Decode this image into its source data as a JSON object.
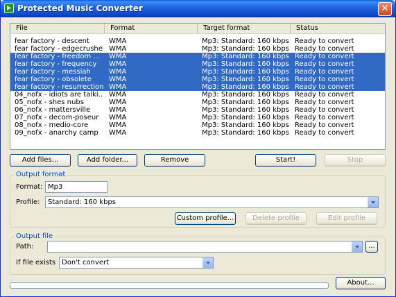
{
  "window": {
    "title": "Protected Music Converter",
    "close_label": "✕"
  },
  "columns": [
    "File",
    "Format",
    "Target format",
    "Status"
  ],
  "rows": [
    {
      "file": "fear factory - descent",
      "format": "WMA",
      "target": "Mp3: Standard: 160 kbps",
      "status": "Ready to convert",
      "selected": false
    },
    {
      "file": "fear factory - edgecrusher",
      "format": "WMA",
      "target": "Mp3: Standard: 160 kbps",
      "status": "Ready to convert",
      "selected": false
    },
    {
      "file": "fear factory - freedom ...",
      "format": "WMA",
      "target": "Mp3: Standard: 160 kbps",
      "status": "Ready to convert",
      "selected": true
    },
    {
      "file": "fear factory - frequency",
      "format": "WMA",
      "target": "Mp3: Standard: 160 kbps",
      "status": "Ready to convert",
      "selected": true
    },
    {
      "file": "fear factory - messiah",
      "format": "WMA",
      "target": "Mp3: Standard: 160 kbps",
      "status": "Ready to convert",
      "selected": true
    },
    {
      "file": "fear factory - obsolete",
      "format": "WMA",
      "target": "Mp3: Standard: 160 kbps",
      "status": "Ready to convert",
      "selected": true
    },
    {
      "file": "fear factory - resurrection",
      "format": "WMA",
      "target": "Mp3: Standard: 160 kbps",
      "status": "Ready to convert",
      "selected": true
    },
    {
      "file": "04_nofx - idiots are talki...",
      "format": "WMA",
      "target": "Mp3: Standard: 160 kbps",
      "status": "Ready to convert",
      "selected": false
    },
    {
      "file": "05_nofx - shes nubs",
      "format": "WMA",
      "target": "Mp3: Standard: 160 kbps",
      "status": "Ready to convert",
      "selected": false
    },
    {
      "file": "06_nofx - mattersville",
      "format": "WMA",
      "target": "Mp3: Standard: 160 kbps",
      "status": "Ready to convert",
      "selected": false
    },
    {
      "file": "07_nofx - decom-poseur",
      "format": "WMA",
      "target": "Mp3: Standard: 160 kbps",
      "status": "Ready to convert",
      "selected": false
    },
    {
      "file": "08_nofx - medio-core",
      "format": "WMA",
      "target": "Mp3: Standard: 160 kbps",
      "status": "Ready to convert",
      "selected": false
    },
    {
      "file": "09_nofx - anarchy camp",
      "format": "WMA",
      "target": "Mp3: Standard: 160 kbps",
      "status": "Ready to convert",
      "selected": false
    }
  ],
  "buttons": {
    "add_files": "Add files...",
    "add_folder": "Add folder...",
    "remove": "Remove",
    "start": "Start!",
    "stop": "Stop",
    "custom_profile": "Custom profile...",
    "delete_profile": "Delete profile",
    "edit_profile": "Edit profile",
    "browse": "...",
    "about": "About..."
  },
  "output_format": {
    "group_title": "Output format",
    "format_label": "Format:",
    "format_value": "Mp3",
    "profile_label": "Profile:",
    "profile_value": "Standard: 160 kbps"
  },
  "output_file": {
    "group_title": "Output file",
    "path_label": "Path:",
    "path_value": "",
    "exists_label": "If file exists",
    "exists_value": "Don't convert"
  },
  "progress": {
    "value": 0
  },
  "colors": {
    "selection": "#316ac5",
    "titlebar": "#0a49c8",
    "group_title": "#0046d5"
  }
}
